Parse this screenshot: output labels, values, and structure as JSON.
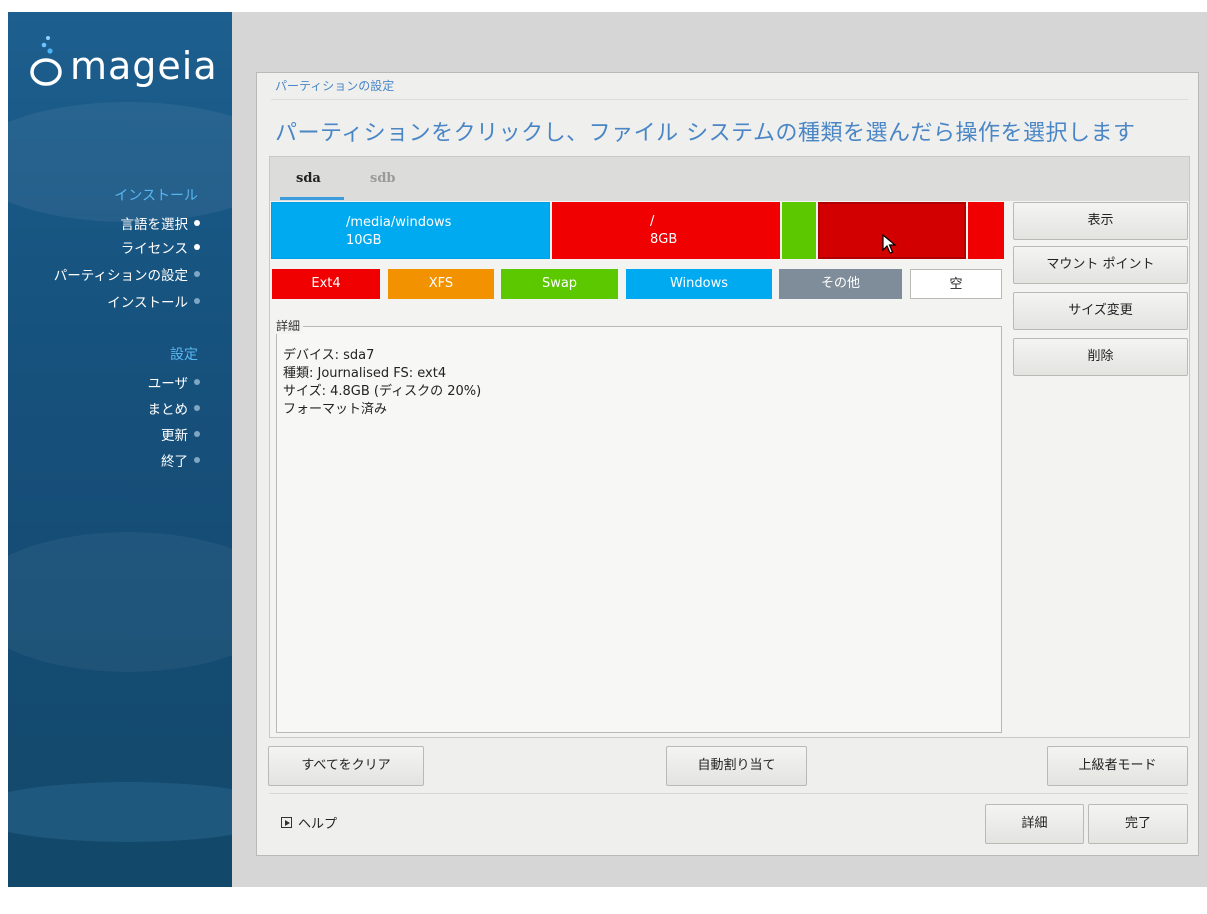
{
  "sidebar": {
    "brand": "mageia",
    "sections": [
      {
        "title": "インストール",
        "items": [
          {
            "label": "言語を選択",
            "state": "done"
          },
          {
            "label": "ライセンス",
            "state": "done"
          },
          {
            "label": "パーティションの設定",
            "state": "current"
          },
          {
            "label": "インストール",
            "state": "pending"
          }
        ]
      },
      {
        "title": "設定",
        "items": [
          {
            "label": "ユーザ",
            "state": "pending"
          },
          {
            "label": "まとめ",
            "state": "pending"
          },
          {
            "label": "更新",
            "state": "pending"
          },
          {
            "label": "終了",
            "state": "pending"
          }
        ]
      }
    ]
  },
  "dialog": {
    "title": "パーティションの設定",
    "heading": "パーティションをクリックし、ファイル システムの種類を選んだら操作を選択します",
    "tabs": [
      {
        "label": "sda",
        "active": true
      },
      {
        "label": "sdb",
        "active": false
      }
    ],
    "partitions": [
      {
        "mount": "/media/windows",
        "size": "10GB",
        "type": "Windows",
        "color": "#00aaf0"
      },
      {
        "mount": "/",
        "size": "8GB",
        "type": "Ext4",
        "color": "#f00000"
      },
      {
        "mount": "",
        "size": "",
        "type": "Swap",
        "color": "#5cc800"
      },
      {
        "mount": "",
        "size": "",
        "type": "Ext4 (selected)",
        "color": "#d20000"
      },
      {
        "mount": "",
        "size": "",
        "type": "Ext4",
        "color": "#f00000"
      }
    ],
    "legend": [
      {
        "label": "Ext4",
        "color": "#f00000"
      },
      {
        "label": "XFS",
        "color": "#f39200"
      },
      {
        "label": "Swap",
        "color": "#5cc800"
      },
      {
        "label": "Windows",
        "color": "#00aaf0"
      },
      {
        "label": "その他",
        "color": "#7f8c99"
      },
      {
        "label": "空",
        "color": "#ffffff"
      }
    ],
    "details": {
      "label": "詳細",
      "lines": [
        "デバイス: sda7",
        "種類: Journalised FS: ext4",
        "サイズ: 4.8GB (ディスクの 20%)",
        "フォーマット済み"
      ]
    },
    "actions": [
      "表示",
      "マウント ポイント",
      "サイズ変更",
      "削除"
    ],
    "buttons": {
      "clear_all": "すべてをクリア",
      "auto_allocate": "自動割り当て",
      "expert_mode": "上級者モード",
      "help": "ヘルプ",
      "details": "詳細",
      "done": "完了"
    }
  }
}
